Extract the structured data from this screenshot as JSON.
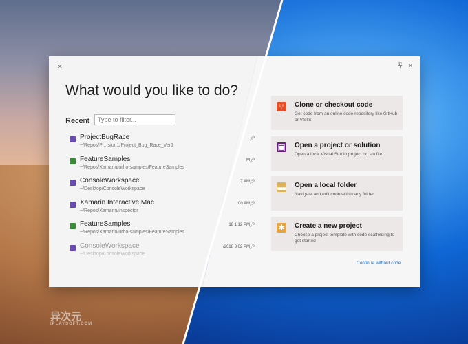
{
  "colors": {
    "accent": "#1a73c9",
    "window_bg": "#f4f4f5",
    "card_bg": "#ece8e8"
  },
  "window": {
    "title": "What would you like to do?",
    "close_icon": "×",
    "pin_icon": "pin-icon"
  },
  "recent": {
    "label": "Recent",
    "filter_placeholder": "Type to filter...",
    "items": [
      {
        "name": "ProjectBugRace",
        "path": "~/Repos/Pr...sion1/Project_Bug_Race_Ver1",
        "time": "",
        "icon_color": "#6a4bb0"
      },
      {
        "name": "FeatureSamples",
        "path": "~/Repos/Xamarin/urho-samples/FeatureSamples",
        "time": "M",
        "icon_color": "#3a8a3a"
      },
      {
        "name": "ConsoleWorkspace",
        "path": "~/Desktop/ConsoleWorkspace",
        "time": "7 AM",
        "icon_color": "#6a4bb0"
      },
      {
        "name": "Xamarin.Interactive.Mac",
        "path": "~/Repos/Xamarin/inspector",
        "time": ":00 AM",
        "icon_color": "#6a4bb0"
      },
      {
        "name": "FeatureSamples",
        "path": "~/Repos/Xamarin/urho-samples/FeatureSamples",
        "time": "18 1:12 PM",
        "icon_color": "#3a8a3a"
      },
      {
        "name": "ConsoleWorkspace",
        "path": "~/Desktop/ConsoleWorkspace",
        "time": "/2018 3:02 PM",
        "icon_color": "#6a4bb0"
      }
    ]
  },
  "actions": [
    {
      "title": "Clone or checkout code",
      "desc": "Get code from an online code repository like GitHub or VSTS",
      "icon": "git-icon",
      "glyph": "⑂",
      "color": "#e44d26"
    },
    {
      "title": "Open a project or solution",
      "desc": "Open a local Visual Studio project or .sln file",
      "icon": "vs-project-icon",
      "glyph": "▣",
      "color": "#68217a"
    },
    {
      "title": "Open a local folder",
      "desc": "Navigate and edit code within any folder",
      "icon": "folder-icon",
      "glyph": "▬",
      "color": "#dcb35c"
    },
    {
      "title": "Create a new project",
      "desc": "Choose a project template with code scaffolding to get started",
      "icon": "new-project-icon",
      "glyph": "✱",
      "color": "#e8a33d"
    }
  ],
  "continue_link": "Continue without code",
  "watermark": {
    "text": "异次元",
    "sub": "IPLAYSOFT.COM"
  }
}
